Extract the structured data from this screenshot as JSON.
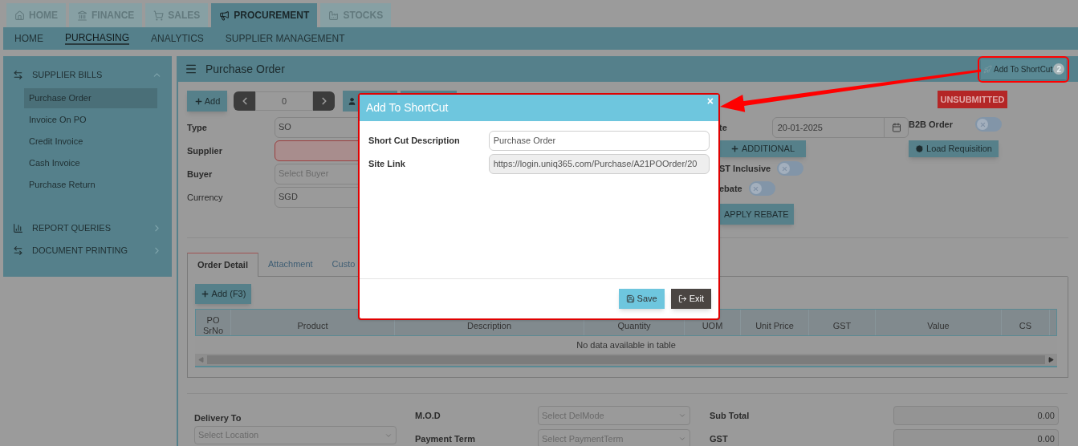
{
  "top_tabs": [
    {
      "label": "HOME",
      "selected": false
    },
    {
      "label": "FINANCE",
      "selected": false
    },
    {
      "label": "SALES",
      "selected": false
    },
    {
      "label": "PROCUREMENT",
      "selected": true
    },
    {
      "label": "STOCKS",
      "selected": false
    }
  ],
  "sub_nav": [
    {
      "label": "HOME",
      "selected": false
    },
    {
      "label": "PURCHASING",
      "selected": true
    },
    {
      "label": "ANALYTICS",
      "selected": false
    },
    {
      "label": "SUPPLIER MANAGEMENT",
      "selected": false
    }
  ],
  "sidebar": {
    "sections": [
      {
        "label": "SUPPLIER BILLS",
        "expanded": true,
        "items": [
          {
            "label": "Purchase Order",
            "selected": true
          },
          {
            "label": "Invoice On PO",
            "selected": false
          },
          {
            "label": "Credit Invoice",
            "selected": false
          },
          {
            "label": "Cash Invoice",
            "selected": false
          },
          {
            "label": "Purchase Return",
            "selected": false
          }
        ]
      },
      {
        "label": "REPORT QUERIES",
        "expanded": false
      },
      {
        "label": "DOCUMENT PRINTING",
        "expanded": false
      }
    ]
  },
  "panel": {
    "title": "Purchase Order",
    "shortcut_button": {
      "label": "Add To ShortCut",
      "badge": "2"
    }
  },
  "toolbar": {
    "add_label": "Add",
    "record_number": "0"
  },
  "status_badge": "UNSUBMITTED",
  "form_fields": [
    {
      "label": "Type",
      "required": true,
      "invalid": false,
      "value": "SO"
    },
    {
      "label": "Supplier",
      "required": true,
      "invalid": true
    },
    {
      "label": "Buyer",
      "required": true,
      "invalid": false,
      "placeholder": "Select Buyer"
    },
    {
      "label": "Currency",
      "required": false,
      "invalid": false,
      "value": "SGD"
    }
  ],
  "date": {
    "label": "te",
    "value": "20-01-2025"
  },
  "additional_button": "ADDITIONAL",
  "toggles": [
    {
      "label": "ST Inclusive",
      "on": false
    },
    {
      "label": "ebate",
      "on": false
    }
  ],
  "apply_rebate_button": "APPLY REBATE",
  "b2b_toggle": {
    "label": "B2B Order",
    "on": false
  },
  "load_requisition_button": "Load Requisition",
  "detail_tabs": [
    {
      "label": "Order Detail",
      "selected": true
    },
    {
      "label": "Attachment",
      "selected": false
    },
    {
      "label": "Custo",
      "selected": false
    }
  ],
  "add_row_button": "Add (F3)",
  "table": {
    "columns": [
      "PO SrNo",
      "Product",
      "Description",
      "Quantity",
      "UOM",
      "Unit Price",
      "GST",
      "Value",
      "CS"
    ],
    "empty_message": "No data available in table"
  },
  "bottom": {
    "delivery": {
      "label": "Delivery To",
      "placeholder": "Select Location"
    },
    "selects": [
      {
        "label": "M.O.D",
        "placeholder": "Select DelMode"
      },
      {
        "label": "Payment Term",
        "placeholder": "Select PaymentTerm"
      }
    ],
    "totals": [
      {
        "label": "Sub Total",
        "value": "0.00"
      },
      {
        "label": "GST",
        "value": "0.00"
      }
    ]
  },
  "modal": {
    "title": "Add To ShortCut",
    "close": "×",
    "fields": [
      {
        "label": "Short Cut Description",
        "value": "Purchase Order",
        "readonly": false
      },
      {
        "label": "Site Link",
        "value": "https://login.uniq365.com/Purchase/A21POOrder/20",
        "readonly": true
      }
    ],
    "buttons": [
      {
        "label": "Save",
        "kind": "primary"
      },
      {
        "label": "Exit",
        "kind": "dark"
      }
    ]
  }
}
